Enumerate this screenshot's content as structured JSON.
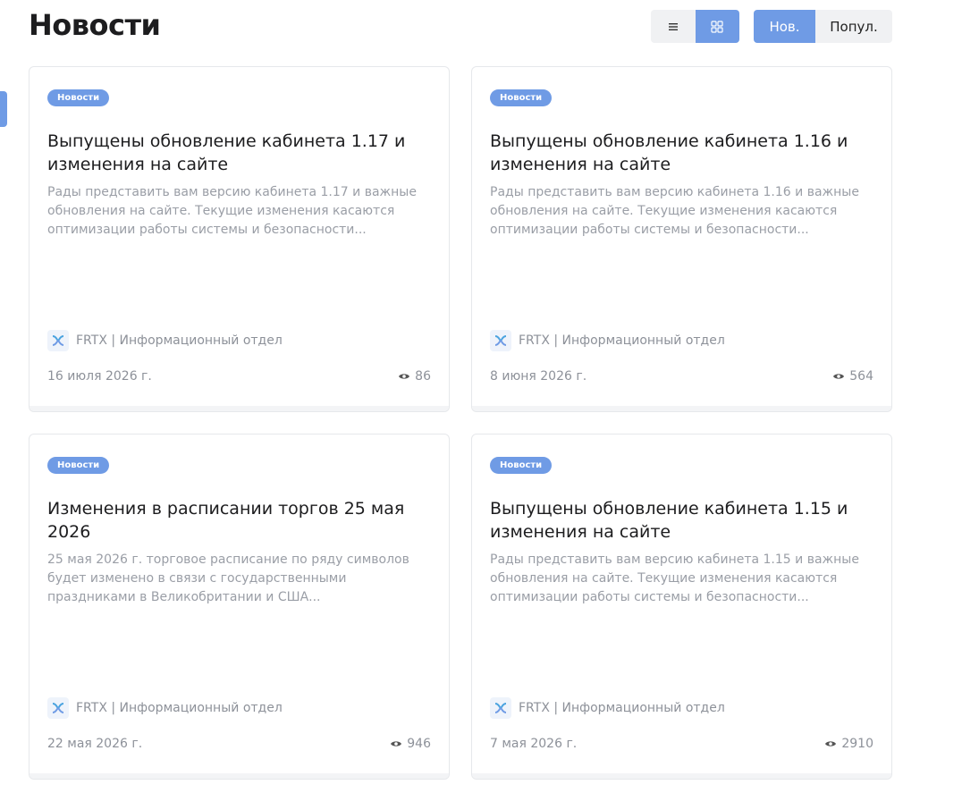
{
  "header": {
    "title": "Новости",
    "view_toggle": {
      "list_icon": "list-icon",
      "grid_icon": "grid-icon",
      "active": "grid"
    },
    "sort_toggle": {
      "newest_label": "Нов.",
      "popular_label": "Попул.",
      "active": "newest"
    }
  },
  "colors": {
    "accent": "#6f9be5",
    "muted_text": "#9a9ea6",
    "title_text": "#1d1d1f"
  },
  "cards": [
    {
      "badge": "Новости",
      "title": "Выпущены обновление кабинета 1.17 и изменения на сайте",
      "excerpt": "Рады представить вам версию кабинета 1.17 и важные обновления на сайте. Текущие изменения касаются оптимизации работы системы и безопасности...",
      "author": "FRTX | Информационный отдел",
      "date": "16 июля 2026 г.",
      "views": "86"
    },
    {
      "badge": "Новости",
      "title": "Выпущены обновление кабинета 1.16 и изменения на сайте",
      "excerpt": "Рады представить вам версию кабинета 1.16 и важные обновления на сайте. Текущие изменения касаются оптимизации работы системы и безопасности...",
      "author": "FRTX | Информационный отдел",
      "date": "8 июня 2026 г.",
      "views": "564"
    },
    {
      "badge": "Новости",
      "title": "Изменения в расписании торгов 25 мая 2026",
      "excerpt": "25 мая 2026 г. торговое расписание по ряду символов будет изменено в связи с государственными праздниками в Великобритании и США...",
      "author": "FRTX | Информационный отдел",
      "date": "22 мая 2026 г.",
      "views": "946"
    },
    {
      "badge": "Новости",
      "title": "Выпущены обновление кабинета 1.15 и изменения на сайте",
      "excerpt": "Рады представить вам версию кабинета 1.15 и важные обновления на сайте. Текущие изменения касаются оптимизации работы системы и безопасности...",
      "author": "FRTX | Информационный отдел",
      "date": "7 мая 2026 г.",
      "views": "2910"
    }
  ]
}
